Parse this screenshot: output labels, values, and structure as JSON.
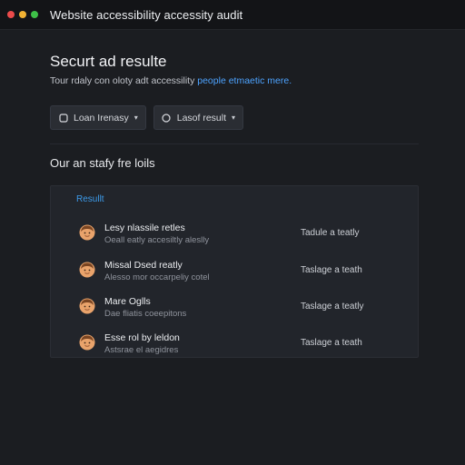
{
  "window": {
    "title": "Website accessibility accessity audit"
  },
  "header": {
    "title": "Securt ad resulte",
    "subtitle_text": "Tour rdaly con oloty adt accessility ",
    "subtitle_link": "people etmaetic mere."
  },
  "filters": [
    {
      "label": "Loan Irenasy",
      "icon": "square-icon"
    },
    {
      "label": "Lasof result",
      "icon": "circle-icon"
    }
  ],
  "section": {
    "heading": "Our an stafy fre loils"
  },
  "results": {
    "label": "Resullt",
    "rows": [
      {
        "title": "Lesy nlassile retles",
        "subtitle": "Oeall eatly accesiltly aleslly",
        "status": "Tadule a teatly"
      },
      {
        "title": "Missal Dsed reatly",
        "subtitle": "Alesso mor occarpeliy cotel",
        "status": "Taslage a teath"
      },
      {
        "title": "Mare Oglls",
        "subtitle": "Dae fliatis coeepitons",
        "status": "Taslage a teatly"
      },
      {
        "title": "Esse rol by leldon",
        "subtitle": "Astsrae el aegidres",
        "status": "Taslage a teath"
      }
    ]
  },
  "colors": {
    "accent": "#4da3ff",
    "background": "#1b1d21",
    "panel": "#22252b"
  }
}
